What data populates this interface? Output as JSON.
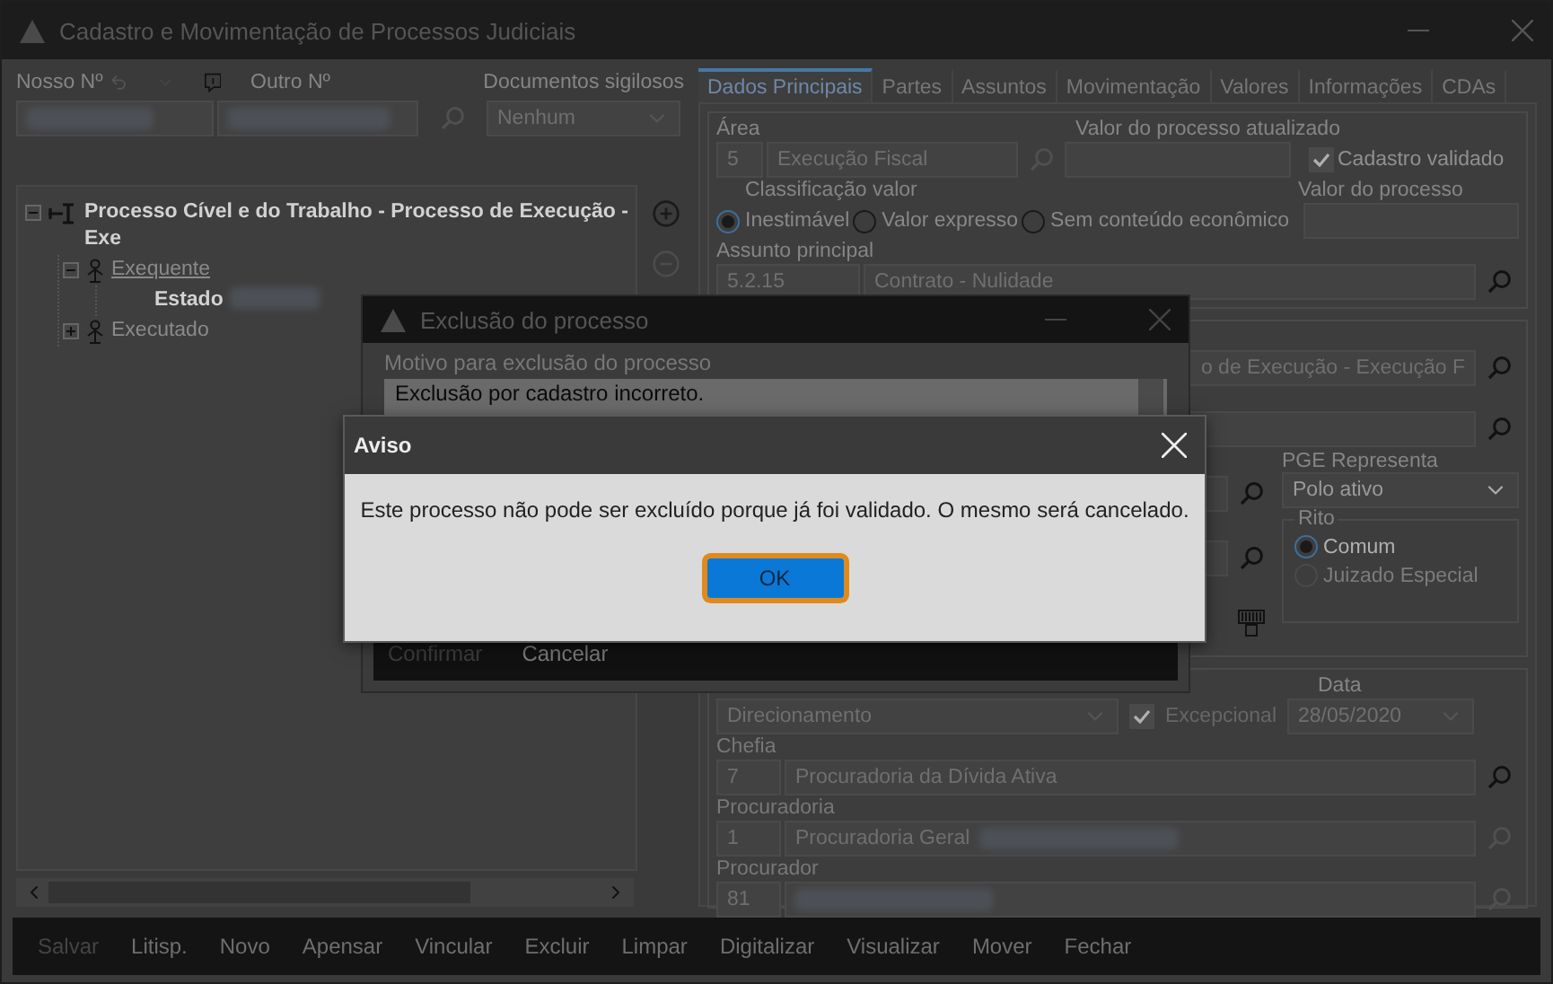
{
  "window": {
    "title": "Cadastro e Movimentação de Processos Judiciais"
  },
  "search_bar": {
    "nosso_label": "Nosso Nº",
    "outro_label": "Outro Nº",
    "docs_label": "Documentos sigilosos",
    "docs_value": "Nenhum"
  },
  "tree": [
    {
      "label": "Processo Cível e do Trabalho - Processo de Execução - Exe",
      "kind": "process",
      "selected": false,
      "expanded": true,
      "children": [
        {
          "label": "Exequente",
          "kind": "party",
          "selected": true,
          "expanded": true,
          "children": [
            {
              "label": "Estado",
              "kind": "entity",
              "selected": false
            }
          ]
        },
        {
          "label": "Executado",
          "kind": "party",
          "selected": false,
          "expanded": false
        }
      ]
    }
  ],
  "tabs": [
    {
      "label": "Dados Principais",
      "selected": true
    },
    {
      "label": "Partes",
      "selected": false
    },
    {
      "label": "Assuntos",
      "selected": false
    },
    {
      "label": "Movimentação",
      "selected": false
    },
    {
      "label": "Valores",
      "selected": false
    },
    {
      "label": "Informações",
      "selected": false
    },
    {
      "label": "CDAs",
      "selected": false
    }
  ],
  "main": {
    "area_label": "Área",
    "area_code": "5",
    "area_name": "Execução Fiscal",
    "valor_atualizado_label": "Valor do processo atualizado",
    "cadastro_validado": {
      "label": "Cadastro validado",
      "checked": true
    },
    "classificacao_label": "Classificação valor",
    "classificacao_options": [
      {
        "label": "Inestimável",
        "selected": true
      },
      {
        "label": "Valor expresso",
        "selected": false
      },
      {
        "label": "Sem conteúdo econômico",
        "selected": false
      }
    ],
    "valor_label": "Valor do processo",
    "assunto_label": "Assunto principal",
    "assunto_code": "5.2.15",
    "assunto_name": "Contrato - Nulidade"
  },
  "details": {
    "tipo_value": "o de Execução - Execução F",
    "pge_label": "PGE Representa",
    "pge_value": "Polo ativo",
    "rito_label": "Rito",
    "rito_options": [
      {
        "label": "Comum",
        "selected": true,
        "disabled": false
      },
      {
        "label": "Juizado Especial",
        "selected": false,
        "disabled": true
      }
    ]
  },
  "assignment": {
    "direcionamento_value": "Direcionamento",
    "excepcional": {
      "label": "Excepcional",
      "checked": true
    },
    "data_label": "Data",
    "data_value": "28/05/2020",
    "rows": [
      {
        "label": "Chefia",
        "code": "7",
        "name": "Procuradoria da Dívida Ativa",
        "redacted": false
      },
      {
        "label": "Procuradoria",
        "code": "1",
        "name": "Procuradoria Geral",
        "redacted": true
      },
      {
        "label": "Procurador",
        "code": "81",
        "redacted": true
      }
    ]
  },
  "toolbar": [
    {
      "label": "Salvar",
      "disabled": true
    },
    {
      "label": "Litisp.",
      "disabled": false
    },
    {
      "label": "Novo",
      "disabled": false
    },
    {
      "label": "Apensar",
      "disabled": false
    },
    {
      "label": "Vincular",
      "disabled": false
    },
    {
      "label": "Excluir",
      "disabled": false
    },
    {
      "label": "Limpar",
      "disabled": false
    },
    {
      "label": "Digitalizar",
      "disabled": false
    },
    {
      "label": "Visualizar",
      "disabled": false
    },
    {
      "label": "Mover",
      "disabled": false
    },
    {
      "label": "Fechar",
      "disabled": false
    }
  ],
  "exclusion_dialog": {
    "title": "Exclusão do processo",
    "reason_label": "Motivo para exclusão do processo",
    "reason_value": "Exclusão por cadastro incorreto.",
    "buttons": [
      {
        "label": "Confirmar",
        "disabled": true
      },
      {
        "label": "Cancelar",
        "disabled": false
      }
    ]
  },
  "alert": {
    "title": "Aviso",
    "message": "Este processo não pode ser excluído porque já foi validado. O mesmo será cancelado.",
    "button": "OK"
  }
}
